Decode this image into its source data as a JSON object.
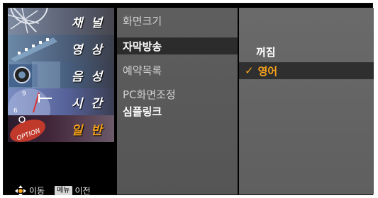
{
  "sidebar": {
    "categories": [
      {
        "label": "채 널",
        "icon": "satellite-dish-icon"
      },
      {
        "label": "영 상",
        "icon": "film-strip-icon"
      },
      {
        "label": "음 성",
        "icon": "speaker-icon"
      },
      {
        "label": "시 간",
        "icon": "clock-icon"
      },
      {
        "label": "일 반",
        "icon": "option-disc-icon"
      }
    ],
    "active_index": 4
  },
  "help": {
    "move_icon": "four-way-arrow-icon",
    "move_label": "이동",
    "menu_key": "메뉴",
    "back_label": "이전"
  },
  "middle_menu": {
    "items": [
      "화면크기",
      "자막방송",
      "예약목록",
      "PC화면조정",
      "심플링크"
    ],
    "selected_index": 1
  },
  "options": {
    "items": [
      "꺼짐",
      "영어"
    ],
    "selected_index": 1,
    "check_mark": "✓"
  },
  "colors": {
    "accent": "#f5a21c",
    "panel": "#5e5e5e",
    "selected_bg": "#2c2c2c",
    "frame": "#000000"
  }
}
